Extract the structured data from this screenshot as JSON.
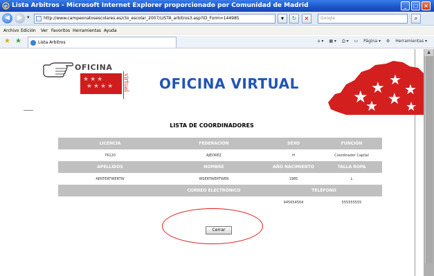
{
  "window": {
    "title": "Lista Arbitros - Microsoft Internet Explorer proporcionado por Comunidad de Madrid"
  },
  "address_bar": {
    "url": "http://www.campeonatosescolares.es/cto_escolar_2007/LISTA_arbitros3.asp?ID_Form=144985",
    "search_placeholder": "Google"
  },
  "menu": {
    "items": [
      "Archivo",
      "Edición",
      "Ver",
      "Favoritos",
      "Herramientas",
      "Ayuda"
    ]
  },
  "tab": {
    "label": "Lista Arbitros"
  },
  "toolbar": {
    "page_label": "Página",
    "tools_label": "Herramientas"
  },
  "header": {
    "logo_word": "OFICINA",
    "logo_side": "virtual",
    "title": "OFICINA VIRTUAL"
  },
  "list": {
    "title": "LISTA DE COORDINADORES",
    "headers1": [
      "LICENCIA",
      "FEDERACIÓN",
      "SEXO",
      "FUNCIÓN"
    ],
    "row1": [
      "76120",
      "AJEDREZ",
      "H",
      "Coordinador Capital"
    ],
    "headers2": [
      "APELLIDOS",
      "NOMBRE",
      "AÑO NACIMIENTO",
      "TALLA ROPA"
    ],
    "row2": [
      "AERTERTWERTW",
      "WSERTWERTWER",
      "1985",
      "L"
    ],
    "headers3": [
      "",
      "CORREO ELECTRÓNICO",
      "TELÉFONO"
    ],
    "row3": [
      "",
      "",
      "945654564",
      "555555555"
    ]
  },
  "actions": {
    "close_label": "Cerrar"
  },
  "colors": {
    "header_gray": "#c0c0c0",
    "brand_blue": "#2255b5",
    "brand_red": "#cf1d1d",
    "annotation_red": "#e01b1b"
  }
}
